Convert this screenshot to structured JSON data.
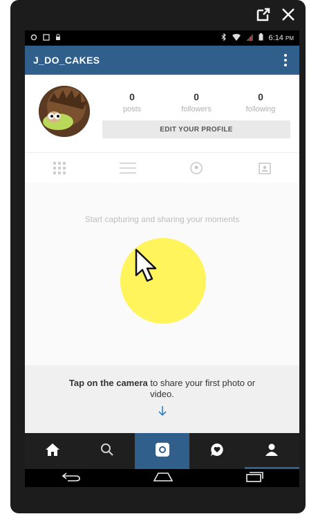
{
  "window_controls": {
    "open_external_icon": "open-external-icon",
    "close_icon": "close-icon"
  },
  "statusbar": {
    "time": "6:14",
    "ampm": "PM"
  },
  "app": {
    "title": "J_DO_CAKES",
    "menu_icon": "overflow-menu-icon"
  },
  "profile": {
    "posts": {
      "count": "0",
      "label": "posts"
    },
    "followers": {
      "count": "0",
      "label": "followers"
    },
    "following": {
      "count": "0",
      "label": "following"
    },
    "edit_button": "EDIT YOUR PROFILE"
  },
  "view_tabs": [
    "grid-view-icon",
    "list-view-icon",
    "location-icon",
    "tagged-photos-icon"
  ],
  "empty_state": {
    "message": "Start capturing and sharing your moments"
  },
  "hint": {
    "bold": "Tap on the camera",
    "rest": " to share your first photo or video."
  },
  "bottom_nav": [
    "home-icon",
    "search-icon",
    "camera-icon",
    "activity-icon",
    "profile-icon"
  ],
  "system_nav": [
    "back-icon",
    "home-button-icon",
    "recent-apps-icon"
  ],
  "colors": {
    "brand_blue": "#2f5f8a",
    "highlight_yellow": "#fff34a"
  }
}
